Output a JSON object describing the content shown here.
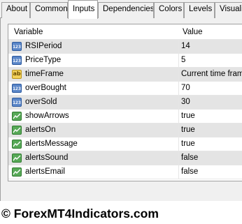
{
  "tabs": [
    {
      "label": "About"
    },
    {
      "label": "Common"
    },
    {
      "label": "Inputs"
    },
    {
      "label": "Dependencies"
    },
    {
      "label": "Colors"
    },
    {
      "label": "Levels"
    },
    {
      "label": "Visualiz"
    }
  ],
  "active_tab": "Inputs",
  "table": {
    "headers": {
      "variable": "Variable",
      "value": "Value"
    },
    "rows": [
      {
        "icon": "int-icon",
        "variable": "RSIPeriod",
        "value": "14"
      },
      {
        "icon": "int-icon",
        "variable": "PriceType",
        "value": "5"
      },
      {
        "icon": "string-icon",
        "variable": "timeFrame",
        "value": "Current time frame"
      },
      {
        "icon": "int-icon",
        "variable": "overBought",
        "value": "70"
      },
      {
        "icon": "int-icon",
        "variable": "overSold",
        "value": "30"
      },
      {
        "icon": "bool-icon",
        "variable": "showArrows",
        "value": "true"
      },
      {
        "icon": "bool-icon",
        "variable": "alertsOn",
        "value": "true"
      },
      {
        "icon": "bool-icon",
        "variable": "alertsMessage",
        "value": "true"
      },
      {
        "icon": "bool-icon",
        "variable": "alertsSound",
        "value": "false"
      },
      {
        "icon": "bool-icon",
        "variable": "alertsEmail",
        "value": "false"
      }
    ],
    "icon_labels": {
      "int": "123",
      "string": "ab"
    }
  },
  "footer": {
    "watermark": "© ForexMT4Indicators.com"
  },
  "colors": {
    "int_icon": "#5a86c8",
    "string_icon": "#f3d15a",
    "bool_icon": "#57a957",
    "alt_row": "#e4e4e4"
  }
}
